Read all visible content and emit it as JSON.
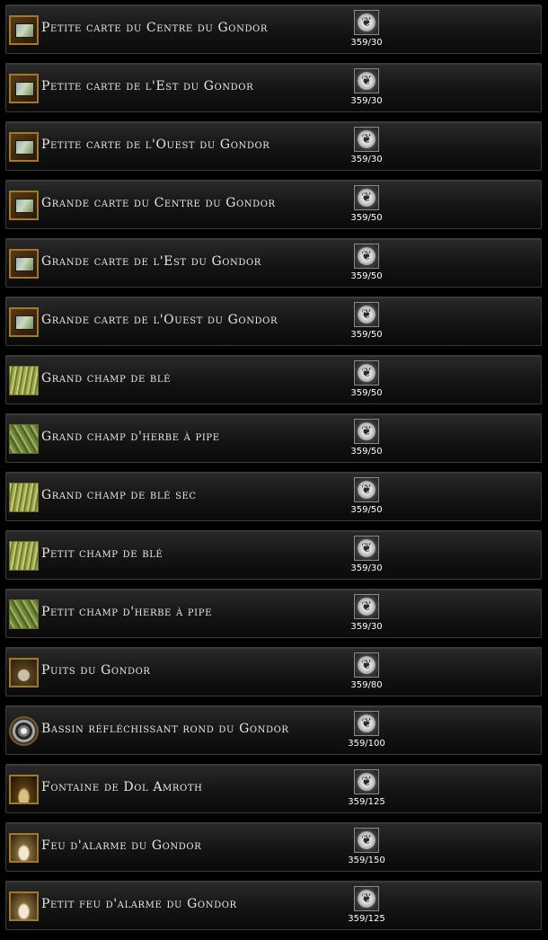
{
  "items": [
    {
      "name": "Petite carte du Centre du Gondor",
      "count": "359/30",
      "icon": "map-icon",
      "kind": "map"
    },
    {
      "name": "Petite carte de l'Est du Gondor",
      "count": "359/30",
      "icon": "map-icon",
      "kind": "map"
    },
    {
      "name": "Petite carte de l'Ouest du Gondor",
      "count": "359/30",
      "icon": "map-icon",
      "kind": "map"
    },
    {
      "name": "Grande carte du Centre du Gondor",
      "count": "359/50",
      "icon": "map-icon",
      "kind": "map"
    },
    {
      "name": "Grande carte de l'Est du Gondor",
      "count": "359/50",
      "icon": "map-icon",
      "kind": "map"
    },
    {
      "name": "Grande carte de l'Ouest du Gondor",
      "count": "359/50",
      "icon": "map-icon",
      "kind": "map"
    },
    {
      "name": "Grand champ de blé",
      "count": "359/50",
      "icon": "wheat-field-icon",
      "kind": "field"
    },
    {
      "name": "Grand champ d'herbe à pipe",
      "count": "359/50",
      "icon": "pipeweed-field-icon",
      "kind": "pipe"
    },
    {
      "name": "Grand champ de blé sec",
      "count": "359/50",
      "icon": "wheat-field-icon",
      "kind": "field"
    },
    {
      "name": "Petit champ de blé",
      "count": "359/30",
      "icon": "wheat-field-icon",
      "kind": "field"
    },
    {
      "name": "Petit champ d'herbe à pipe",
      "count": "359/30",
      "icon": "pipeweed-field-icon",
      "kind": "pipe"
    },
    {
      "name": "Puits du Gondor",
      "count": "359/80",
      "icon": "well-icon",
      "kind": "well"
    },
    {
      "name": "Bassin réfléchissant rond du Gondor",
      "count": "359/100",
      "icon": "reflecting-pool-icon",
      "kind": "basin"
    },
    {
      "name": "Fontaine de Dol Amroth",
      "count": "359/125",
      "icon": "fountain-icon",
      "kind": "fountain"
    },
    {
      "name": "Feu d'alarme du Gondor",
      "count": "359/150",
      "icon": "beacon-icon",
      "kind": "beacon"
    },
    {
      "name": "Petit feu d'alarme du Gondor",
      "count": "359/125",
      "icon": "beacon-icon",
      "kind": "beacon"
    }
  ],
  "currency_icon": "white-tree-token-icon"
}
